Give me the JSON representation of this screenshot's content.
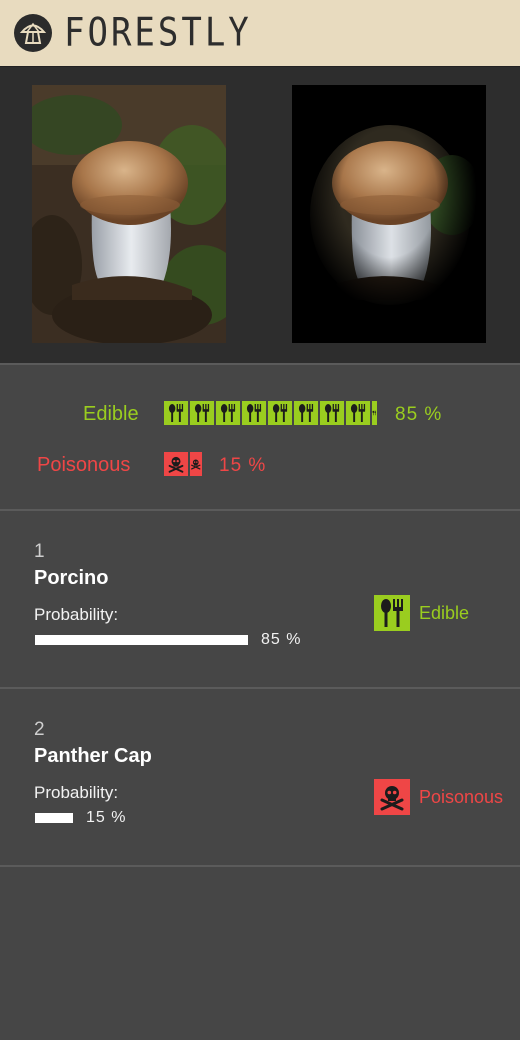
{
  "app": {
    "title": "FORESTLY"
  },
  "images": [
    {
      "name": "original-photo"
    },
    {
      "name": "processed-photo"
    }
  ],
  "summary": {
    "edible": {
      "label": "Edible",
      "percent": "85 %",
      "value": 85
    },
    "poisonous": {
      "label": "Poisonous",
      "percent": "15 %",
      "value": 15
    }
  },
  "results": [
    {
      "rank": "1",
      "name": "Porcino",
      "prob_label": "Probability:",
      "percent": "85 %",
      "value": 85,
      "class_label": "Edible",
      "class_type": "edible"
    },
    {
      "rank": "2",
      "name": "Panther Cap",
      "prob_label": "Probability:",
      "percent": "15 %",
      "value": 15,
      "class_label": "Poisonous",
      "class_type": "poisonous"
    }
  ],
  "colors": {
    "edible": "#9acd1f",
    "poisonous": "#ef4646",
    "header_bg": "#e8dbbf",
    "panel_bg": "#464646"
  },
  "icons": [
    "mushroom-logo-icon",
    "fork-spoon-icon",
    "skull-crossbones-icon"
  ]
}
